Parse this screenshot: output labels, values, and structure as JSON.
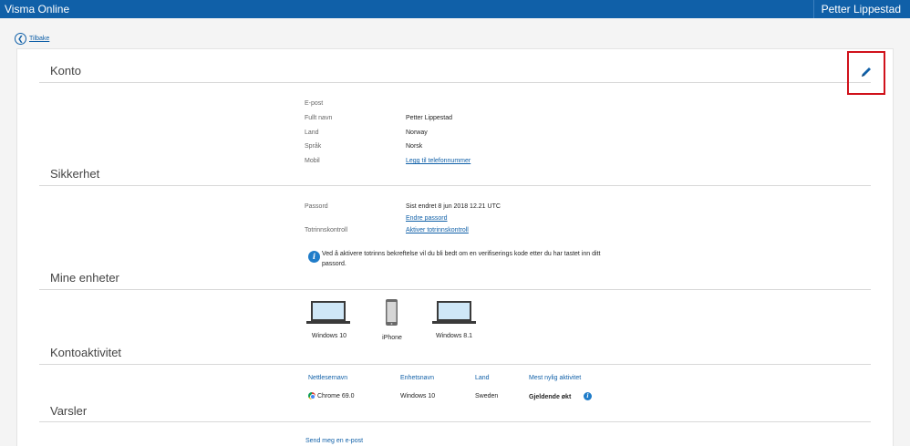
{
  "header": {
    "app_title": "Visma Online",
    "user_name": "Petter Lippestad"
  },
  "nav": {
    "back_label": "Tilbake"
  },
  "konto": {
    "title": "Konto",
    "fields": [
      {
        "label": "E-post",
        "value": ""
      },
      {
        "label": "Fullt navn",
        "value": "Petter Lippestad"
      },
      {
        "label": "Land",
        "value": "Norway"
      },
      {
        "label": "Språk",
        "value": "Norsk"
      },
      {
        "label": "Mobil",
        "value": "Legg til telefonnummer"
      }
    ],
    "edit_icon": "pencil-icon"
  },
  "sikkerhet": {
    "title": "Sikkerhet",
    "password_label": "Passord",
    "password_value": "Sist endret 8 jun 2018 12.21 UTC",
    "change_password_link": "Endre passord",
    "twofactor_label": "Totrinnskontroll",
    "twofactor_link": "Aktiver totrinnskontroll",
    "info_text": "Ved å aktivere totrinns bekreftelse vil du bli bedt om en verifiserings kode etter du har tastet inn ditt passord."
  },
  "enheter": {
    "title": "Mine enheter",
    "devices": [
      {
        "label": "Windows 10",
        "icon": "laptop-icon"
      },
      {
        "label": "iPhone",
        "icon": "phone-icon"
      },
      {
        "label": "Windows 8.1",
        "icon": "laptop-icon"
      }
    ]
  },
  "aktivitet": {
    "title": "Kontoaktivitet",
    "columns": [
      "Nettlesernavn",
      "Enhetsnavn",
      "Land",
      "Mest nylig aktivitet"
    ],
    "row": {
      "browser": "Chrome 69.0",
      "device": "Windows 10",
      "country": "Sweden",
      "activity": "Gjeldende økt"
    }
  },
  "varsler": {
    "title": "Varsler",
    "link": "Send meg en e-post"
  },
  "colors": {
    "brand": "#1060a8",
    "highlight": "#d0121b",
    "info": "#1f7cc9"
  }
}
